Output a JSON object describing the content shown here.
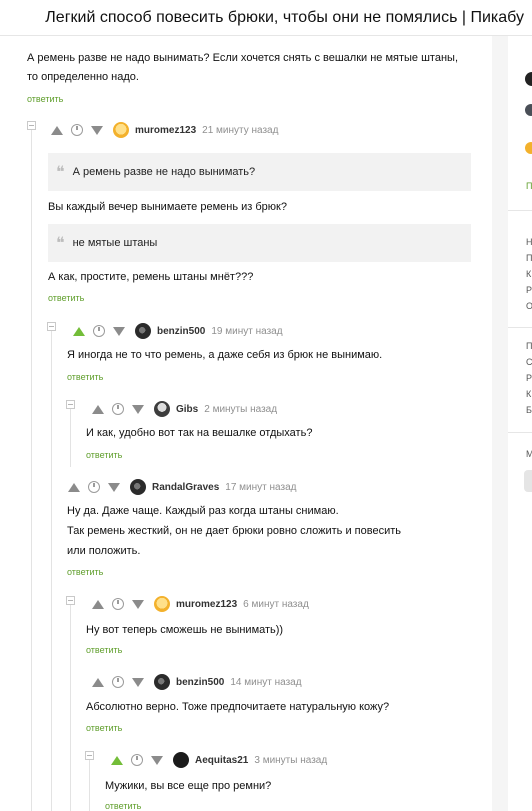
{
  "page_title": "Легкий способ повесить брюки, чтобы они не помялись | Пикабу",
  "comments": [
    {
      "id": "c0",
      "author": "",
      "time": "",
      "text": [
        "А ремень разве не надо вынимать? Если хочется снять с вешалки не мятые штаны,",
        "то определенно надо."
      ],
      "reply": "ответить"
    },
    {
      "id": "c1",
      "author": "muromez123",
      "time": "21 минуту назад",
      "quote1": "А ремень разве не надо вынимать?",
      "text1": "Вы каждый вечер вынимаете ремень из брюк?",
      "quote2": "не мятые штаны",
      "text2": "А как, простите, ремень штаны мнёт???",
      "reply": "ответить"
    },
    {
      "id": "c2",
      "author": "benzin500",
      "time": "19 минут назад",
      "text": [
        "Я иногда не то что ремень, а даже себя из брюк не вынимаю."
      ],
      "reply": "ответить"
    },
    {
      "id": "c3",
      "author": "Gibs",
      "time": "2 минуты назад",
      "text": [
        "И как, удобно вот так на вешалке отдыхать?"
      ],
      "reply": "ответить"
    },
    {
      "id": "c4",
      "author": "RandalGraves",
      "time": "17 минут назад",
      "text": [
        "Ну да. Даже чаще. Каждый раз когда штаны снимаю.",
        "Так ремень жесткий, он не дает брюки ровно сложить и повесить",
        "или положить."
      ],
      "reply": "ответить"
    },
    {
      "id": "c5",
      "author": "muromez123",
      "time": "6 минут назад",
      "text": [
        "Ну вот теперь сможешь не вынимать))"
      ],
      "reply": "ответить"
    },
    {
      "id": "c6",
      "author": "benzin500",
      "time": "14 минут назад",
      "text": [
        "Абсолютно верно. Тоже предпочитаете натуральную кожу?"
      ],
      "reply": "ответить"
    },
    {
      "id": "c7",
      "author": "Aequitas21",
      "time": "3 минуты назад",
      "text": [
        "Мужики, вы все еще про ремни?"
      ],
      "reply": "ответить"
    }
  ],
  "sidebar": {
    "letters": [
      "П",
      "Н",
      "П",
      "К",
      "Р",
      "О",
      "П",
      "С",
      "Р",
      "К",
      "Б",
      "М"
    ]
  },
  "colors": {
    "reply_link": "#5f9e2b",
    "vote_up_active": "#73bd38",
    "quote_bg": "#f2f2f2"
  }
}
